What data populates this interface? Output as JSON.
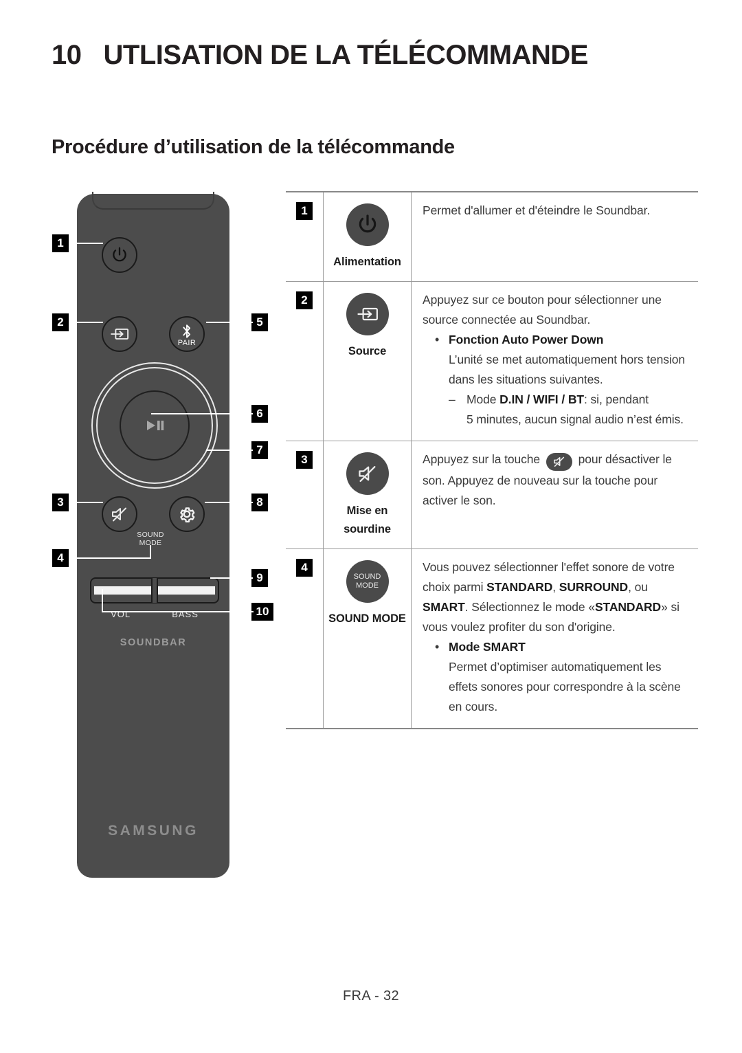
{
  "header": {
    "chapter_number": "10",
    "chapter_title": "UTLISATION DE LA TÉLÉCOMMANDE",
    "section_title": "Procédure d’utilisation de la télécommande"
  },
  "footer": {
    "page_label": "FRA - 32"
  },
  "remote": {
    "brand": "SAMSUNG",
    "product_label": "SOUNDBAR",
    "pair_label": "PAIR",
    "sound_mode_line1": "SOUND",
    "sound_mode_line2": "MODE",
    "vol_label": "VOL",
    "bass_label": "BASS",
    "callouts": [
      {
        "number": "1",
        "target": "power-button"
      },
      {
        "number": "2",
        "target": "source-button"
      },
      {
        "number": "3",
        "target": "mute-button"
      },
      {
        "number": "4",
        "target": "sound-mode-button"
      },
      {
        "number": "5",
        "target": "bluetooth-pair-button"
      },
      {
        "number": "6",
        "target": "play-pause-button"
      },
      {
        "number": "7",
        "target": "navigation-ring"
      },
      {
        "number": "8",
        "target": "settings-button"
      },
      {
        "number": "9",
        "target": "volume-bass-rocker"
      },
      {
        "number": "10",
        "target": "volume-bass-rocker-left"
      }
    ]
  },
  "table": {
    "rows": [
      {
        "number": "1",
        "button_icon": "power-icon",
        "button_label": "Alimentation",
        "description": [
          {
            "kind": "text",
            "runs": [
              {
                "t": "Permet d'allumer et d'éteindre le Soundbar."
              }
            ]
          }
        ]
      },
      {
        "number": "2",
        "button_icon": "source-icon",
        "button_label": "Source",
        "description": [
          {
            "kind": "text",
            "runs": [
              {
                "t": "Appuyez sur ce bouton pour sélectionner une source connectée au Soundbar."
              }
            ]
          },
          {
            "kind": "bullet",
            "bullet": "•",
            "runs": [
              {
                "t": "Fonction Auto Power Down",
                "b": true
              }
            ]
          },
          {
            "kind": "sub",
            "runs": [
              {
                "t": "L’unité se met automatiquement hors tension dans les situations suivantes."
              }
            ]
          },
          {
            "kind": "dash",
            "dash": "–",
            "runs": [
              {
                "t": "Mode "
              },
              {
                "t": "D.IN / WIFI / BT",
                "b": true
              },
              {
                "t": ": si, pendant"
              }
            ]
          },
          {
            "kind": "subsub",
            "runs": [
              {
                "t": "5 minutes, aucun signal audio n’est émis."
              }
            ]
          }
        ]
      },
      {
        "number": "3",
        "button_icon": "mute-icon",
        "button_label": "Mise en\nsourdine",
        "button_label_line1": "Mise en",
        "button_label_line2": "sourdine",
        "description": [
          {
            "kind": "text-with-inline-icon",
            "pre": "Appuyez sur la touche",
            "inline_icon": "mute-icon",
            "post": "pour désactiver le son.  Appuyez de nouveau sur la touche pour activer le son."
          }
        ]
      },
      {
        "number": "4",
        "button_icon": "sound-mode-text",
        "button_label": "SOUND MODE",
        "description": [
          {
            "kind": "text",
            "runs": [
              {
                "t": "Vous pouvez sélectionner l'effet sonore de votre choix parmi "
              },
              {
                "t": "STANDARD",
                "b": true
              },
              {
                "t": ", "
              },
              {
                "t": "SURROUND",
                "b": true
              },
              {
                "t": ", ou "
              },
              {
                "t": "SMART",
                "b": true
              },
              {
                "t": ". Sélectionnez le mode «"
              },
              {
                "t": "STANDARD",
                "b": true
              },
              {
                "t": "» si vous voulez profiter du son d'origine."
              }
            ]
          },
          {
            "kind": "bullet",
            "bullet": "•",
            "runs": [
              {
                "t": "Mode SMART",
                "b": true
              }
            ]
          },
          {
            "kind": "sub",
            "runs": [
              {
                "t": "Permet d’optimiser automatiquement les effets sonores pour correspondre à la scène en cours."
              }
            ]
          }
        ]
      }
    ]
  },
  "colors": {
    "remote_body": "#4c4c4c",
    "button_fill": "#4a4a4a",
    "badge_bg": "#000000",
    "text": "#3b3b3b",
    "rule": "#9a9a9a"
  }
}
